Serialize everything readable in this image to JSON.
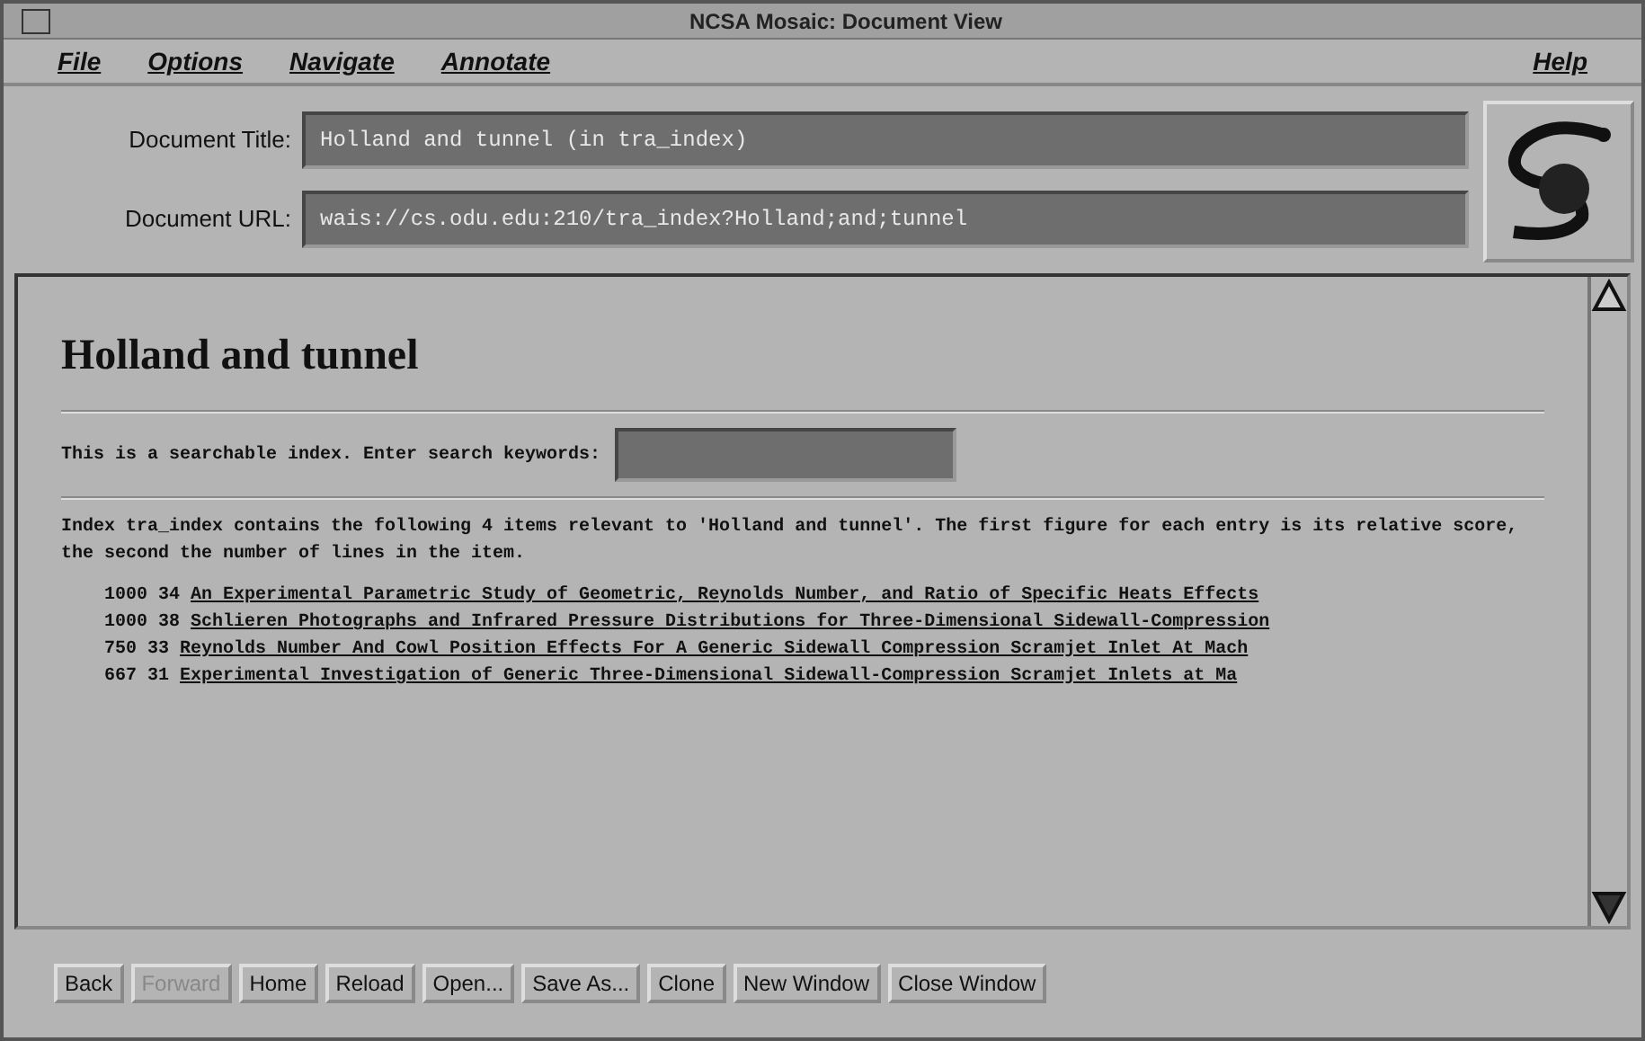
{
  "window": {
    "title": "NCSA Mosaic: Document View"
  },
  "menu": [
    {
      "label": "File"
    },
    {
      "label": "Options"
    },
    {
      "label": "Navigate"
    },
    {
      "label": "Annotate"
    },
    {
      "label": "Help"
    }
  ],
  "document_title": {
    "label": "Document Title:",
    "value": "Holland and tunnel (in tra_index)"
  },
  "document_url": {
    "label": "Document URL:",
    "value": "wais://cs.odu.edu:210/tra_index?Holland;and;tunnel"
  },
  "page": {
    "heading": "Holland and tunnel",
    "search_prompt": "This is a searchable index. Enter search keywords:",
    "intro": "Index tra_index contains the following 4 items relevant to 'Holland and tunnel'. The first figure for each entry is its relative score, the second the number of lines in the item.",
    "results": [
      {
        "score": "1000 34",
        "title": "An Experimental Parametric Study of Geometric, Reynolds Number, and Ratio of Specific Heats Effects"
      },
      {
        "score": "1000 38",
        "title": "Schlieren Photographs and Infrared Pressure Distributions for Three-Dimensional Sidewall-Compression"
      },
      {
        "score": "750 33",
        "title": "Reynolds Number And Cowl Position Effects For A Generic Sidewall Compression Scramjet Inlet At Mach"
      },
      {
        "score": "667 31",
        "title": "Experimental Investigation of Generic Three-Dimensional Sidewall-Compression Scramjet Inlets at Ma"
      }
    ]
  },
  "buttons": [
    {
      "label": "Back",
      "disabled": false
    },
    {
      "label": "Forward",
      "disabled": true
    },
    {
      "label": "Home",
      "disabled": false
    },
    {
      "label": "Reload",
      "disabled": false
    },
    {
      "label": "Open...",
      "disabled": false
    },
    {
      "label": "Save As...",
      "disabled": false
    },
    {
      "label": "Clone",
      "disabled": false
    },
    {
      "label": "New Window",
      "disabled": false
    },
    {
      "label": "Close Window",
      "disabled": false
    }
  ]
}
